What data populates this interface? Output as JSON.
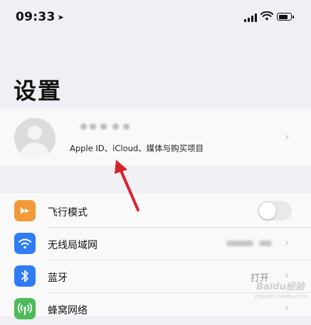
{
  "status_bar": {
    "time": "09:33",
    "location_icon": "location-arrow-icon",
    "signal_icon": "cellular-signal-icon",
    "wifi_icon": "wifi-icon",
    "battery_icon": "battery-icon",
    "battery_level": 0.8
  },
  "page": {
    "title": "设置"
  },
  "account": {
    "avatar_icon": "person-avatar-icon",
    "subtitle": "Apple ID、iCloud、媒体与购买项目",
    "chevron_icon": "chevron-right-icon"
  },
  "settings_list": [
    {
      "label": "飞行模式",
      "icon": "airplane-icon",
      "icon_color": "#f29a38",
      "control": "toggle",
      "toggle_on": false
    },
    {
      "label": "无线局域网",
      "icon": "wifi-icon",
      "icon_color": "#2f7cf6",
      "control": "blurred-value"
    },
    {
      "label": "蓝牙",
      "icon": "bluetooth-icon",
      "icon_color": "#2f7cf6",
      "control": "value",
      "value": "打开"
    },
    {
      "label": "蜂窝网络",
      "icon": "cellular-antenna-icon",
      "icon_color": "#4cbc5a",
      "control": "chevron"
    }
  ],
  "annotation": {
    "arrow_color": "#d7232a",
    "arrow_icon": "red-pointer-arrow-icon"
  },
  "watermark": {
    "text": "Baidu经验",
    "sub": "jingyan.baidu.com"
  }
}
